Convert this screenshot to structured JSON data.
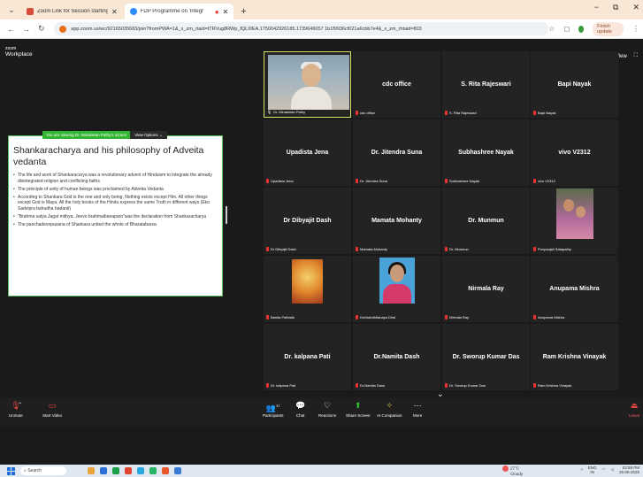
{
  "browser": {
    "tabs": [
      {
        "label": "Zoom Link for Session starting",
        "icon_color": "#4a8cf0",
        "active": false
      },
      {
        "label": "FDP Programme on 'Integr",
        "icon_color": "#2d8cff",
        "active": true
      }
    ],
    "url": "app.zoom.us/wc/92165035683/join?fromPWA=1&_x_zm_rtaid=tTRVug8RWp_fQLI0EA.1750042926185.1739646057 1b1f9936cf021a6cbb7e4&_x_zm_rhtaid=803",
    "update_label": "Finish update",
    "window_controls": [
      "−",
      "⧉",
      "✕"
    ]
  },
  "zoom": {
    "logo_small": "zoom",
    "logo_large": "Workplace",
    "view_label": "View",
    "viewing_label": "You are viewing  Dr. Minaketan Pathy's screen",
    "view_options": "View Options",
    "slide": {
      "title": "Shankaracharya and his philosophy of Adveita vedanta",
      "bullets": [
        "The life and work of Shankaracarya was a revolutionary advent of Hinduism to integrate the already disintegrated religion and conflicting faiths",
        "The principle of unity of human beings was proclaimed by Adveita Vedanta",
        "According to Shankara God is the one and only being, Nothing exists except Him. All other things except God is Maya. All the holy books of the Hindu express the same Truth in different ways (Eko Sadvipra bahudha badanti)",
        "\"Brahma satya Jagat mithya, Jeevo brahmaibanaparo\"was the declaration from Shankaracharya",
        "The panchadevopasana of Shankara united the whole of Bharatabarsa"
      ]
    },
    "participants": [
      {
        "name": "",
        "label": "Dr. Minaketan Pathy",
        "photo": "man",
        "active": true
      },
      {
        "name": "cdc office",
        "label": "cdc office",
        "photo": ""
      },
      {
        "name": "S. Rita Rajeswari",
        "label": "S. Rita Rajeswari",
        "photo": ""
      },
      {
        "name": "Bapi Nayak",
        "label": "Bapi Nayak",
        "photo": ""
      },
      {
        "name": "Upadista Jena",
        "label": "Upadista Jena",
        "photo": ""
      },
      {
        "name": "Dr. Jitendra Suna",
        "label": "Dr. Jitendra Suna",
        "photo": ""
      },
      {
        "name": "Subhashree Nayak",
        "label": "Subhashree Nayak",
        "photo": ""
      },
      {
        "name": "vivo V2312",
        "label": "vivo V2312",
        "photo": ""
      },
      {
        "name": "Dr Dibyajit Dash",
        "label": "Dr Dibyajit Dash",
        "photo": ""
      },
      {
        "name": "Mamata Mohanty",
        "label": "Mamata Mohanty",
        "photo": ""
      },
      {
        "name": "Dr. Munmun",
        "label": "Dr. Munmun",
        "photo": ""
      },
      {
        "name": "",
        "label": "Poopanjali Satapathy",
        "photo": "girls"
      },
      {
        "name": "",
        "label": "Banita Pattnaik",
        "photo": "ganesh"
      },
      {
        "name": "",
        "label": "Kshirabdhitanaya Dhal",
        "photo": "woman"
      },
      {
        "name": "Nirmala Ray",
        "label": "Nirmala Ray",
        "photo": ""
      },
      {
        "name": "Anupama Mishra",
        "label": "Anupama Mishra",
        "photo": ""
      },
      {
        "name": "Dr. kalpana Pati",
        "label": "Dr. kalpana Pati",
        "photo": ""
      },
      {
        "name": "Dr.Namita Dash",
        "label": "Dr.Namita Dash",
        "photo": ""
      },
      {
        "name": "Dr. Sworup Kumar Das",
        "label": "Dr. Sworup Kumar Das",
        "photo": ""
      },
      {
        "name": "Ram Krishna Vinayak",
        "label": "Ram Krishna Vinayak",
        "photo": ""
      }
    ],
    "controls": {
      "unmute": "Unmute",
      "start_video": "Start Video",
      "participants": "Participants",
      "participants_count": "37",
      "chat": "Chat",
      "reactions": "Reactions",
      "share_screen": "Share Screen",
      "ai_companion": "AI Companion",
      "more": "More",
      "leave": "Leave"
    }
  },
  "taskbar": {
    "search_placeholder": "Search",
    "temperature": "27°C",
    "weather": "Cloudy",
    "lang": "ENG",
    "region": "IN",
    "time": "03:59 PM",
    "date": "25-06-2025",
    "app_colors": [
      "#e8a33a",
      "#2b6fd6",
      "#1a9e4a",
      "#e0452f",
      "#2aa6e0",
      "#28b463",
      "#e85a2c",
      "#3a7bd5"
    ]
  }
}
